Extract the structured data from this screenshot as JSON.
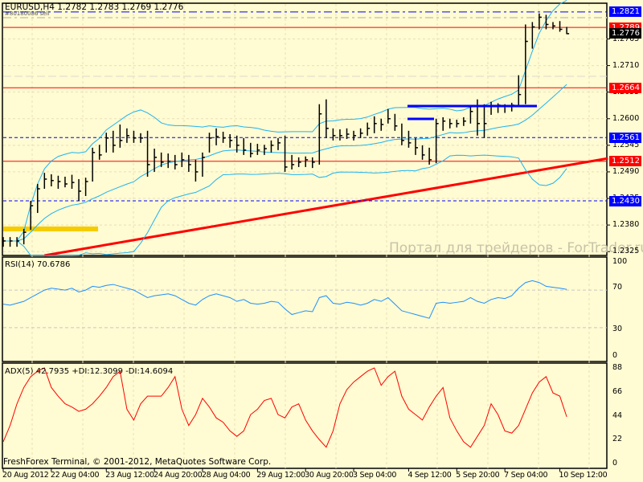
{
  "header": {
    "title": "EURUSD,H4  1.2782 1.2783 1.2769 1.2776",
    "order_label": "#80180086 sell"
  },
  "footer": "FreshForex Terminal, © 2001-2012, MetaQuotes Software Corp.",
  "watermark": "Портал для трейдеров - ForTrader.ru",
  "colors": {
    "background": "#fffbd2",
    "bars": "#000000",
    "bands": "#1eb4f0",
    "level_red": "#ff0000",
    "level_blue": "#0000ff",
    "trend": "#ff0000",
    "adx": "#ff0000",
    "rsi": "#1e90ff"
  },
  "chart_data": {
    "type": "ohlc",
    "symbol": "EURUSD",
    "timeframe": "H4",
    "ylim": [
      1.2317,
      1.2839
    ],
    "bars_hlc": [
      [
        1.2355,
        1.2335,
        1.2347
      ],
      [
        1.2355,
        1.2335,
        1.2347
      ],
      [
        1.2355,
        1.2335,
        1.2347
      ],
      [
        1.2372,
        1.234,
        1.2365
      ],
      [
        1.243,
        1.237,
        1.242
      ],
      [
        1.2465,
        1.2405,
        1.2455
      ],
      [
        1.2488,
        1.2455,
        1.2475
      ],
      [
        1.2485,
        1.246,
        1.2472
      ],
      [
        1.2482,
        1.2455,
        1.247
      ],
      [
        1.248,
        1.2458,
        1.2465
      ],
      [
        1.2484,
        1.2455,
        1.2468
      ],
      [
        1.2475,
        1.243,
        1.245
      ],
      [
        1.2478,
        1.244,
        1.247
      ],
      [
        1.254,
        1.247,
        1.253
      ],
      [
        1.2546,
        1.2515,
        1.2525
      ],
      [
        1.2571,
        1.253,
        1.256
      ],
      [
        1.2575,
        1.253,
        1.2545
      ],
      [
        1.2588,
        1.254,
        1.2555
      ],
      [
        1.258,
        1.255,
        1.2565
      ],
      [
        1.2575,
        1.255,
        1.256
      ],
      [
        1.257,
        1.255,
        1.256
      ],
      [
        1.2575,
        1.248,
        1.2505
      ],
      [
        1.2538,
        1.249,
        1.252
      ],
      [
        1.253,
        1.25,
        1.251
      ],
      [
        1.2528,
        1.2498,
        1.2512
      ],
      [
        1.2525,
        1.2495,
        1.2505
      ],
      [
        1.253,
        1.25,
        1.2515
      ],
      [
        1.2525,
        1.249,
        1.2505
      ],
      [
        1.2515,
        1.247,
        1.249
      ],
      [
        1.253,
        1.248,
        1.252
      ],
      [
        1.2571,
        1.253,
        1.256
      ],
      [
        1.258,
        1.2545,
        1.2563
      ],
      [
        1.2573,
        1.255,
        1.256
      ],
      [
        1.2568,
        1.254,
        1.2555
      ],
      [
        1.2565,
        1.253,
        1.2545
      ],
      [
        1.256,
        1.2525,
        1.2535
      ],
      [
        1.255,
        1.252,
        1.2528
      ],
      [
        1.2548,
        1.2525,
        1.2535
      ],
      [
        1.2546,
        1.2525,
        1.2538
      ],
      [
        1.2555,
        1.253,
        1.2545
      ],
      [
        1.256,
        1.2535,
        1.255
      ],
      [
        1.2565,
        1.249,
        1.25
      ],
      [
        1.2525,
        1.2495,
        1.2505
      ],
      [
        1.252,
        1.25,
        1.251
      ],
      [
        1.2522,
        1.25,
        1.2515
      ],
      [
        1.252,
        1.2498,
        1.251
      ],
      [
        1.263,
        1.2505,
        1.261
      ],
      [
        1.264,
        1.256,
        1.258
      ],
      [
        1.258,
        1.2555,
        1.2565
      ],
      [
        1.2578,
        1.2555,
        1.2565
      ],
      [
        1.258,
        1.2558,
        1.2568
      ],
      [
        1.2575,
        1.2555,
        1.2565
      ],
      [
        1.258,
        1.256,
        1.257
      ],
      [
        1.2592,
        1.2565,
        1.258
      ],
      [
        1.2605,
        1.257,
        1.259
      ],
      [
        1.26,
        1.2575,
        1.2588
      ],
      [
        1.262,
        1.259,
        1.26
      ],
      [
        1.261,
        1.2575,
        1.2585
      ],
      [
        1.259,
        1.2545,
        1.2555
      ],
      [
        1.2575,
        1.254,
        1.255
      ],
      [
        1.256,
        1.2525,
        1.254
      ],
      [
        1.2545,
        1.2515,
        1.2525
      ],
      [
        1.254,
        1.2505,
        1.2515
      ],
      [
        1.26,
        1.2508,
        1.259
      ],
      [
        1.2603,
        1.2575,
        1.2595
      ],
      [
        1.26,
        1.258,
        1.259
      ],
      [
        1.2598,
        1.2582,
        1.259
      ],
      [
        1.2603,
        1.2585,
        1.2595
      ],
      [
        1.2625,
        1.259,
        1.2615
      ],
      [
        1.264,
        1.2565,
        1.259
      ],
      [
        1.263,
        1.256,
        1.259
      ],
      [
        1.2635,
        1.2608,
        1.2625
      ],
      [
        1.2632,
        1.2612,
        1.2628
      ],
      [
        1.263,
        1.2612,
        1.2625
      ],
      [
        1.2633,
        1.2615,
        1.2628
      ],
      [
        1.269,
        1.2628,
        1.265
      ],
      [
        1.2795,
        1.263,
        1.276
      ],
      [
        1.28,
        1.2745,
        1.279
      ],
      [
        1.2818,
        1.2785,
        1.281
      ],
      [
        1.2815,
        1.2785,
        1.2795
      ],
      [
        1.28,
        1.2785,
        1.2792
      ],
      [
        1.2802,
        1.278,
        1.2785
      ],
      [
        1.279,
        1.2775,
        1.2776
      ]
    ],
    "levels": [
      {
        "price": 1.2821,
        "label": "1.2821",
        "color": "#0000ff",
        "style": "dashdot"
      },
      {
        "price": 1.2789,
        "label": "1.2789",
        "color": "#ff0000",
        "style": "solid"
      },
      {
        "price": 1.2776,
        "label": "1.2776",
        "color": "#000000",
        "style": "none"
      },
      {
        "price": 1.2664,
        "label": "1.2664",
        "color": "#ff0000",
        "style": "solid"
      },
      {
        "price": 1.2561,
        "label": "1.2561",
        "color": "#0000ff",
        "style": "dashed"
      },
      {
        "price": 1.2512,
        "label": "1.2512",
        "color": "#ff0000",
        "style": "solid"
      },
      {
        "price": 1.243,
        "label": "1.2430",
        "color": "#0000ff",
        "style": "dashed"
      }
    ],
    "trendline": {
      "from_bar": 6,
      "from_price": 1.2317,
      "to_bar": 88,
      "to_price": 1.2518
    },
    "price_ticks": [
      "1.2765",
      "1.2710",
      "1.2655",
      "1.2600",
      "1.2545",
      "1.2490",
      "1.2435",
      "1.2380",
      "1.2325"
    ],
    "x_ticks": [
      {
        "bar": 0,
        "label": "20 Aug 2012"
      },
      {
        "bar": 7,
        "label": "22 Aug 04:00"
      },
      {
        "bar": 15,
        "label": "23 Aug 12:00"
      },
      {
        "bar": 22,
        "label": "24 Aug 20:00"
      },
      {
        "bar": 29,
        "label": "28 Aug 04:00"
      },
      {
        "bar": 37,
        "label": "29 Aug 12:00"
      },
      {
        "bar": 44,
        "label": "30 Aug 20:00"
      },
      {
        "bar": 51,
        "label": "3 Sep 04:00"
      },
      {
        "bar": 59,
        "label": "4 Sep 12:00"
      },
      {
        "bar": 66,
        "label": "5 Sep 20:00"
      },
      {
        "bar": 73,
        "label": "7 Sep 04:00"
      },
      {
        "bar": 81,
        "label": "10 Sep 12:00"
      }
    ],
    "rsi": {
      "title": "RSI(14) 70.6786",
      "ylim": [
        0,
        100
      ],
      "ticks": [
        "100",
        "70",
        "30",
        "0"
      ],
      "levels": [
        70,
        30
      ],
      "values": [
        55,
        54,
        56,
        58,
        62,
        66,
        70,
        72,
        71,
        70,
        72,
        68,
        70,
        74,
        73,
        75,
        76,
        74,
        72,
        70,
        66,
        62,
        64,
        65,
        66,
        64,
        60,
        56,
        54,
        60,
        64,
        66,
        64,
        62,
        58,
        60,
        56,
        55,
        56,
        58,
        57,
        50,
        44,
        46,
        48,
        47,
        62,
        64,
        56,
        55,
        57,
        56,
        54,
        56,
        60,
        58,
        62,
        55,
        48,
        46,
        44,
        42,
        40,
        56,
        57,
        56,
        57,
        58,
        62,
        58,
        56,
        60,
        62,
        61,
        64,
        72,
        78,
        80,
        78,
        74,
        73,
        72,
        70.7
      ]
    },
    "adx": {
      "title": "ADX(5) 42.7935 +DI:12.3099 -DI:14.6094",
      "ylim": [
        0,
        88
      ],
      "ticks": [
        "88",
        "66",
        "44",
        "22",
        "0"
      ],
      "values": [
        20,
        35,
        55,
        70,
        80,
        85,
        88,
        70,
        62,
        55,
        52,
        48,
        50,
        55,
        62,
        70,
        80,
        85,
        50,
        40,
        55,
        62,
        62,
        62,
        70,
        80,
        50,
        35,
        45,
        60,
        52,
        42,
        38,
        30,
        25,
        30,
        45,
        50,
        58,
        60,
        45,
        42,
        52,
        55,
        40,
        30,
        22,
        15,
        30,
        55,
        68,
        75,
        80,
        85,
        88,
        72,
        80,
        85,
        62,
        50,
        45,
        40,
        52,
        62,
        70,
        42,
        30,
        20,
        15,
        25,
        35,
        55,
        45,
        30,
        28,
        35,
        50,
        65,
        75,
        80,
        65,
        62,
        43
      ]
    }
  }
}
